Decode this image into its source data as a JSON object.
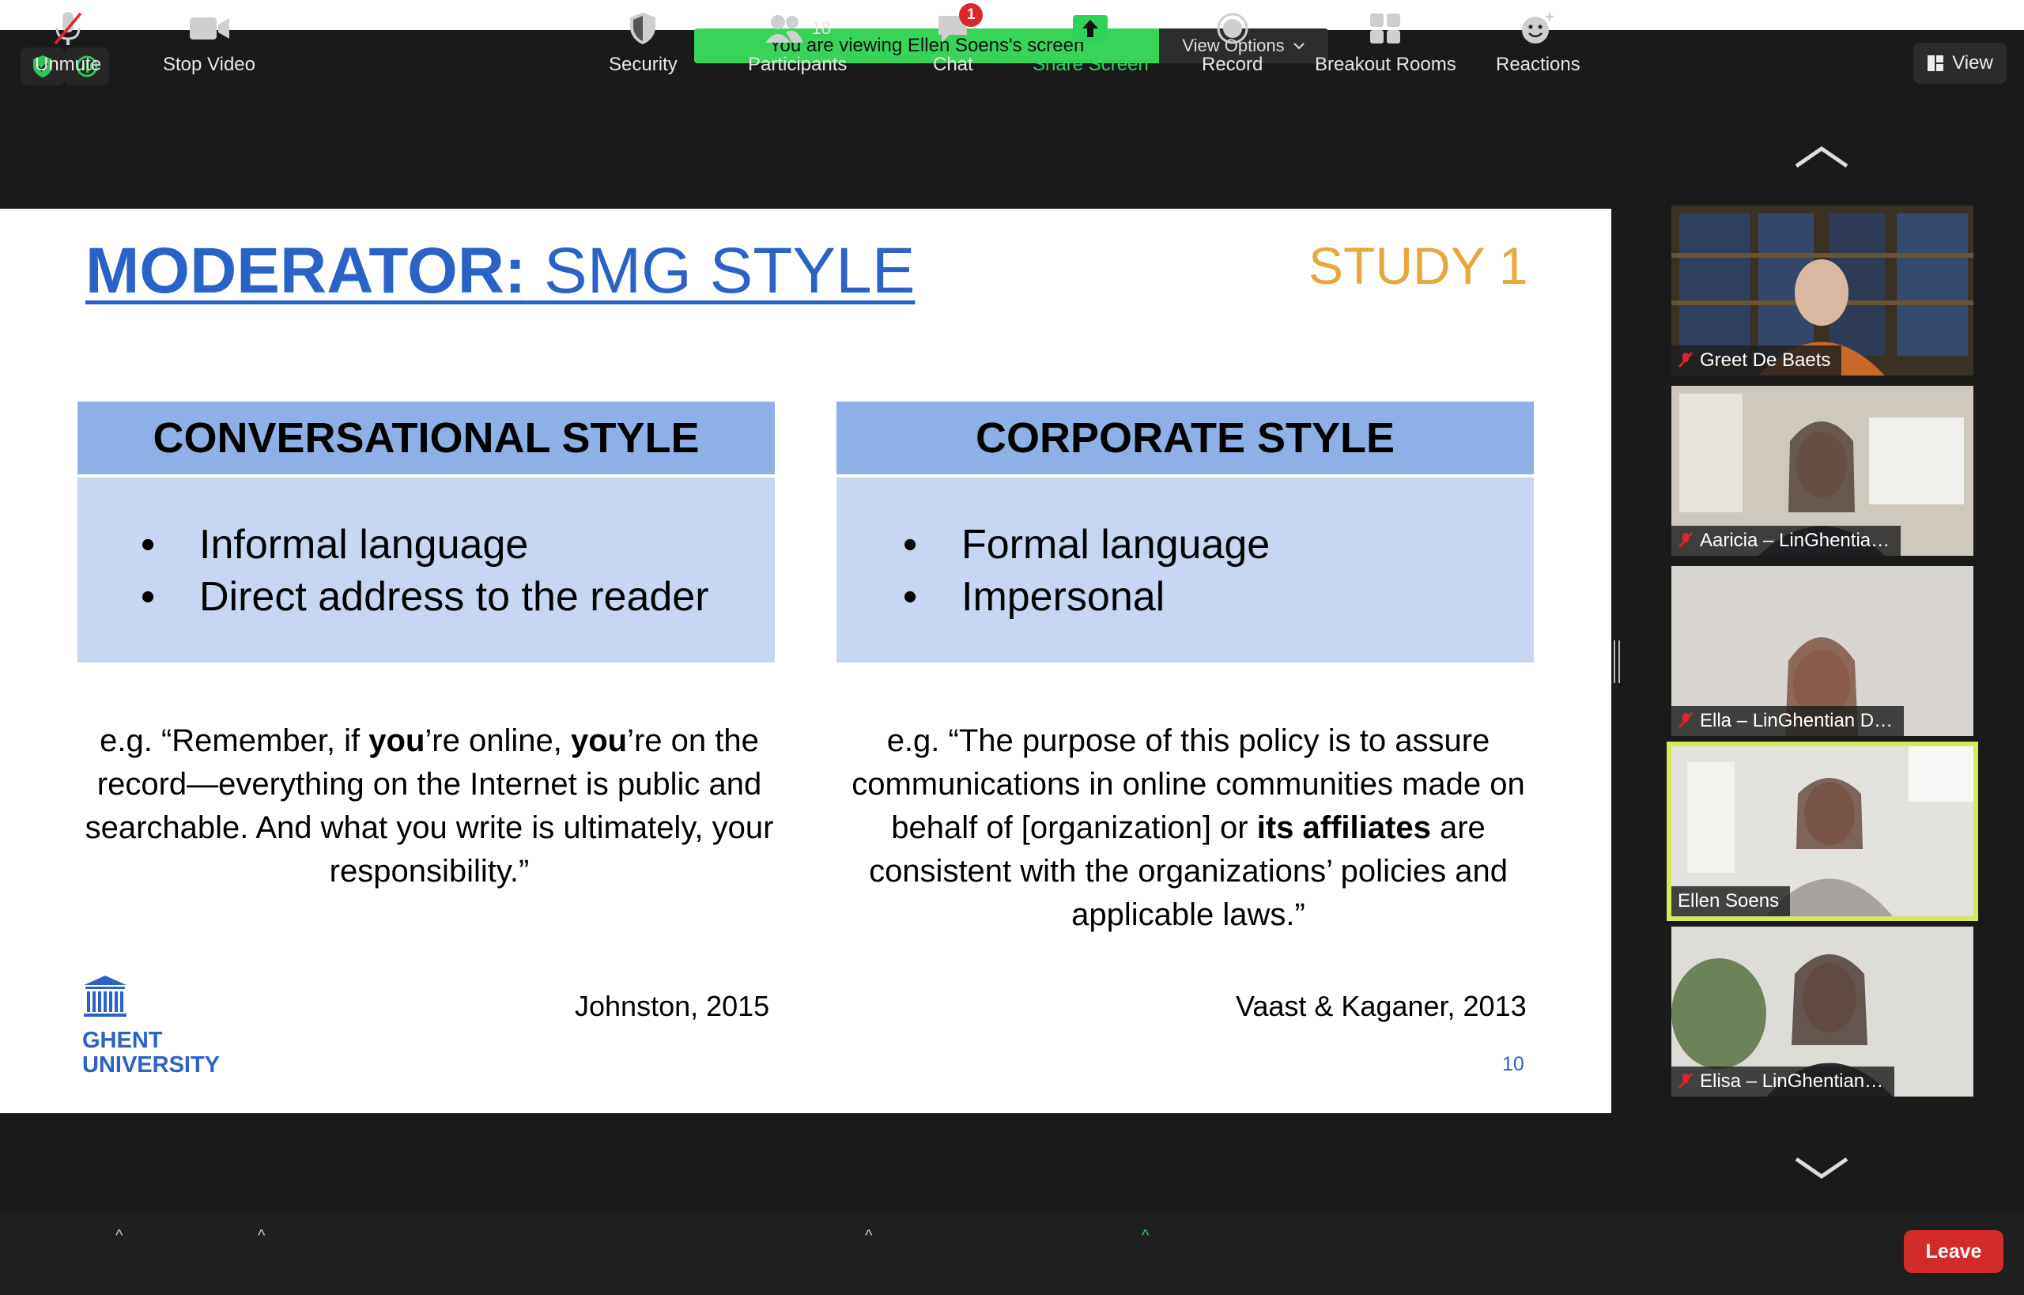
{
  "banner": {
    "message": "You are viewing Ellen Soens's screen",
    "view_options_label": "View Options"
  },
  "view_button": {
    "label": "View"
  },
  "slide": {
    "title_bold": "MODERATOR:",
    "title_rest": " SMG STYLE",
    "study_label": "STUDY 1",
    "left_box": {
      "header": "CONVERSATIONAL STYLE",
      "bullets": [
        "Informal language",
        "Direct address to the reader"
      ]
    },
    "right_box": {
      "header": "CORPORATE STYLE",
      "bullets": [
        "Formal language",
        "Impersonal"
      ]
    },
    "left_quote": {
      "p1": "e.g. “Remember, if ",
      "b1": "you",
      "p2": "’re online, ",
      "b2": "you",
      "p3": "’re on the record—everything on the Internet is public and searchable. And what you write is ultimately, your responsibility.”"
    },
    "right_quote": {
      "p1": "e.g. “The purpose of this policy is to assure communications in online communities made on behalf of [organization] or ",
      "b1": "its affiliates",
      "p2": " are consistent with the organizations’ policies and applicable laws.”"
    },
    "left_citation": "Johnston, 2015",
    "right_citation": "Vaast & Kaganer, 2013",
    "page_number": "10",
    "logo_line1": "GHENT",
    "logo_line2": "UNIVERSITY"
  },
  "participants": [
    {
      "name": "Greet De Baets",
      "muted": true
    },
    {
      "name": "Aaricia – LinGhentia…",
      "muted": true
    },
    {
      "name": "Ella – LinGhentian D…",
      "muted": true
    },
    {
      "name": "Ellen Soens",
      "muted": false,
      "active_speaker": true
    },
    {
      "name": "Elisa – LinGhentian…",
      "muted": true
    }
  ],
  "toolbar": {
    "unmute": "Unmute",
    "stop_video": "Stop Video",
    "security": "Security",
    "participants": "Participants",
    "participants_count": "18",
    "chat": "Chat",
    "chat_badge": "1",
    "share_screen": "Share Screen",
    "record": "Record",
    "breakout_rooms": "Breakout Rooms",
    "reactions": "Reactions",
    "leave": "Leave"
  },
  "colors": {
    "banner_green": "#38d459",
    "slide_blue": "#2a62c8",
    "study_orange": "#e8a73b",
    "box_header": "#8fb0e6",
    "box_body": "#c6d6f3",
    "active_border": "#d7e85a",
    "share_green": "#2fd25a",
    "leave_red": "#d32a2a"
  }
}
